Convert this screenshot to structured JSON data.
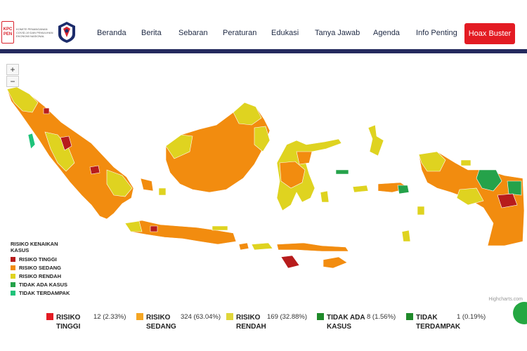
{
  "logo": {
    "kpc_top": "KPC",
    "kpc_bottom": "PEN",
    "tagline": "KOMITE PENANGANAN COVID-19 DAN PEMULIHAN EKONOMI NASIONAL"
  },
  "nav": {
    "items": [
      "Beranda",
      "Berita",
      "Sebaran",
      "Peraturan",
      "Edukasi",
      "Tanya Jawab",
      "Agenda",
      "Info Penting"
    ],
    "hoax_label": "Hoax Buster"
  },
  "map": {
    "zoom_in": "+",
    "zoom_out": "−",
    "credits": "Highcharts.com",
    "legend": {
      "title": "RISIKO KENAIKAN KASUS",
      "items": [
        {
          "label": "RISIKO TINGGI",
          "color": "#b71c1c"
        },
        {
          "label": "RISIKO SEDANG",
          "color": "#f28c0f"
        },
        {
          "label": "RISIKO RENDAH",
          "color": "#dfd320"
        },
        {
          "label": "TIDAK ADA KASUS",
          "color": "#25a24a"
        },
        {
          "label": "TIDAK TERDAMPAK",
          "color": "#1ec37a"
        }
      ]
    }
  },
  "stats": [
    {
      "label_line1": "RISIKO",
      "label_line2": "TINGGI",
      "value": "12 (2.33%)",
      "color": "#e31b23"
    },
    {
      "label_line1": "RISIKO",
      "label_line2": "SEDANG",
      "value": "324 (63.04%)",
      "color": "#f5a623"
    },
    {
      "label_line1": "RISIKO",
      "label_line2": "RENDAH",
      "value": "169 (32.88%)",
      "color": "#e0d63a"
    },
    {
      "label_line1": "TIDAK ADA",
      "label_line2": "KASUS",
      "value": "8 (1.56%)",
      "color": "#1f8a2a"
    },
    {
      "label_line1": "TIDAK",
      "label_line2": "TERDAMPAK",
      "value": "1 (0.19%)",
      "color": "#1f8a2a"
    }
  ]
}
